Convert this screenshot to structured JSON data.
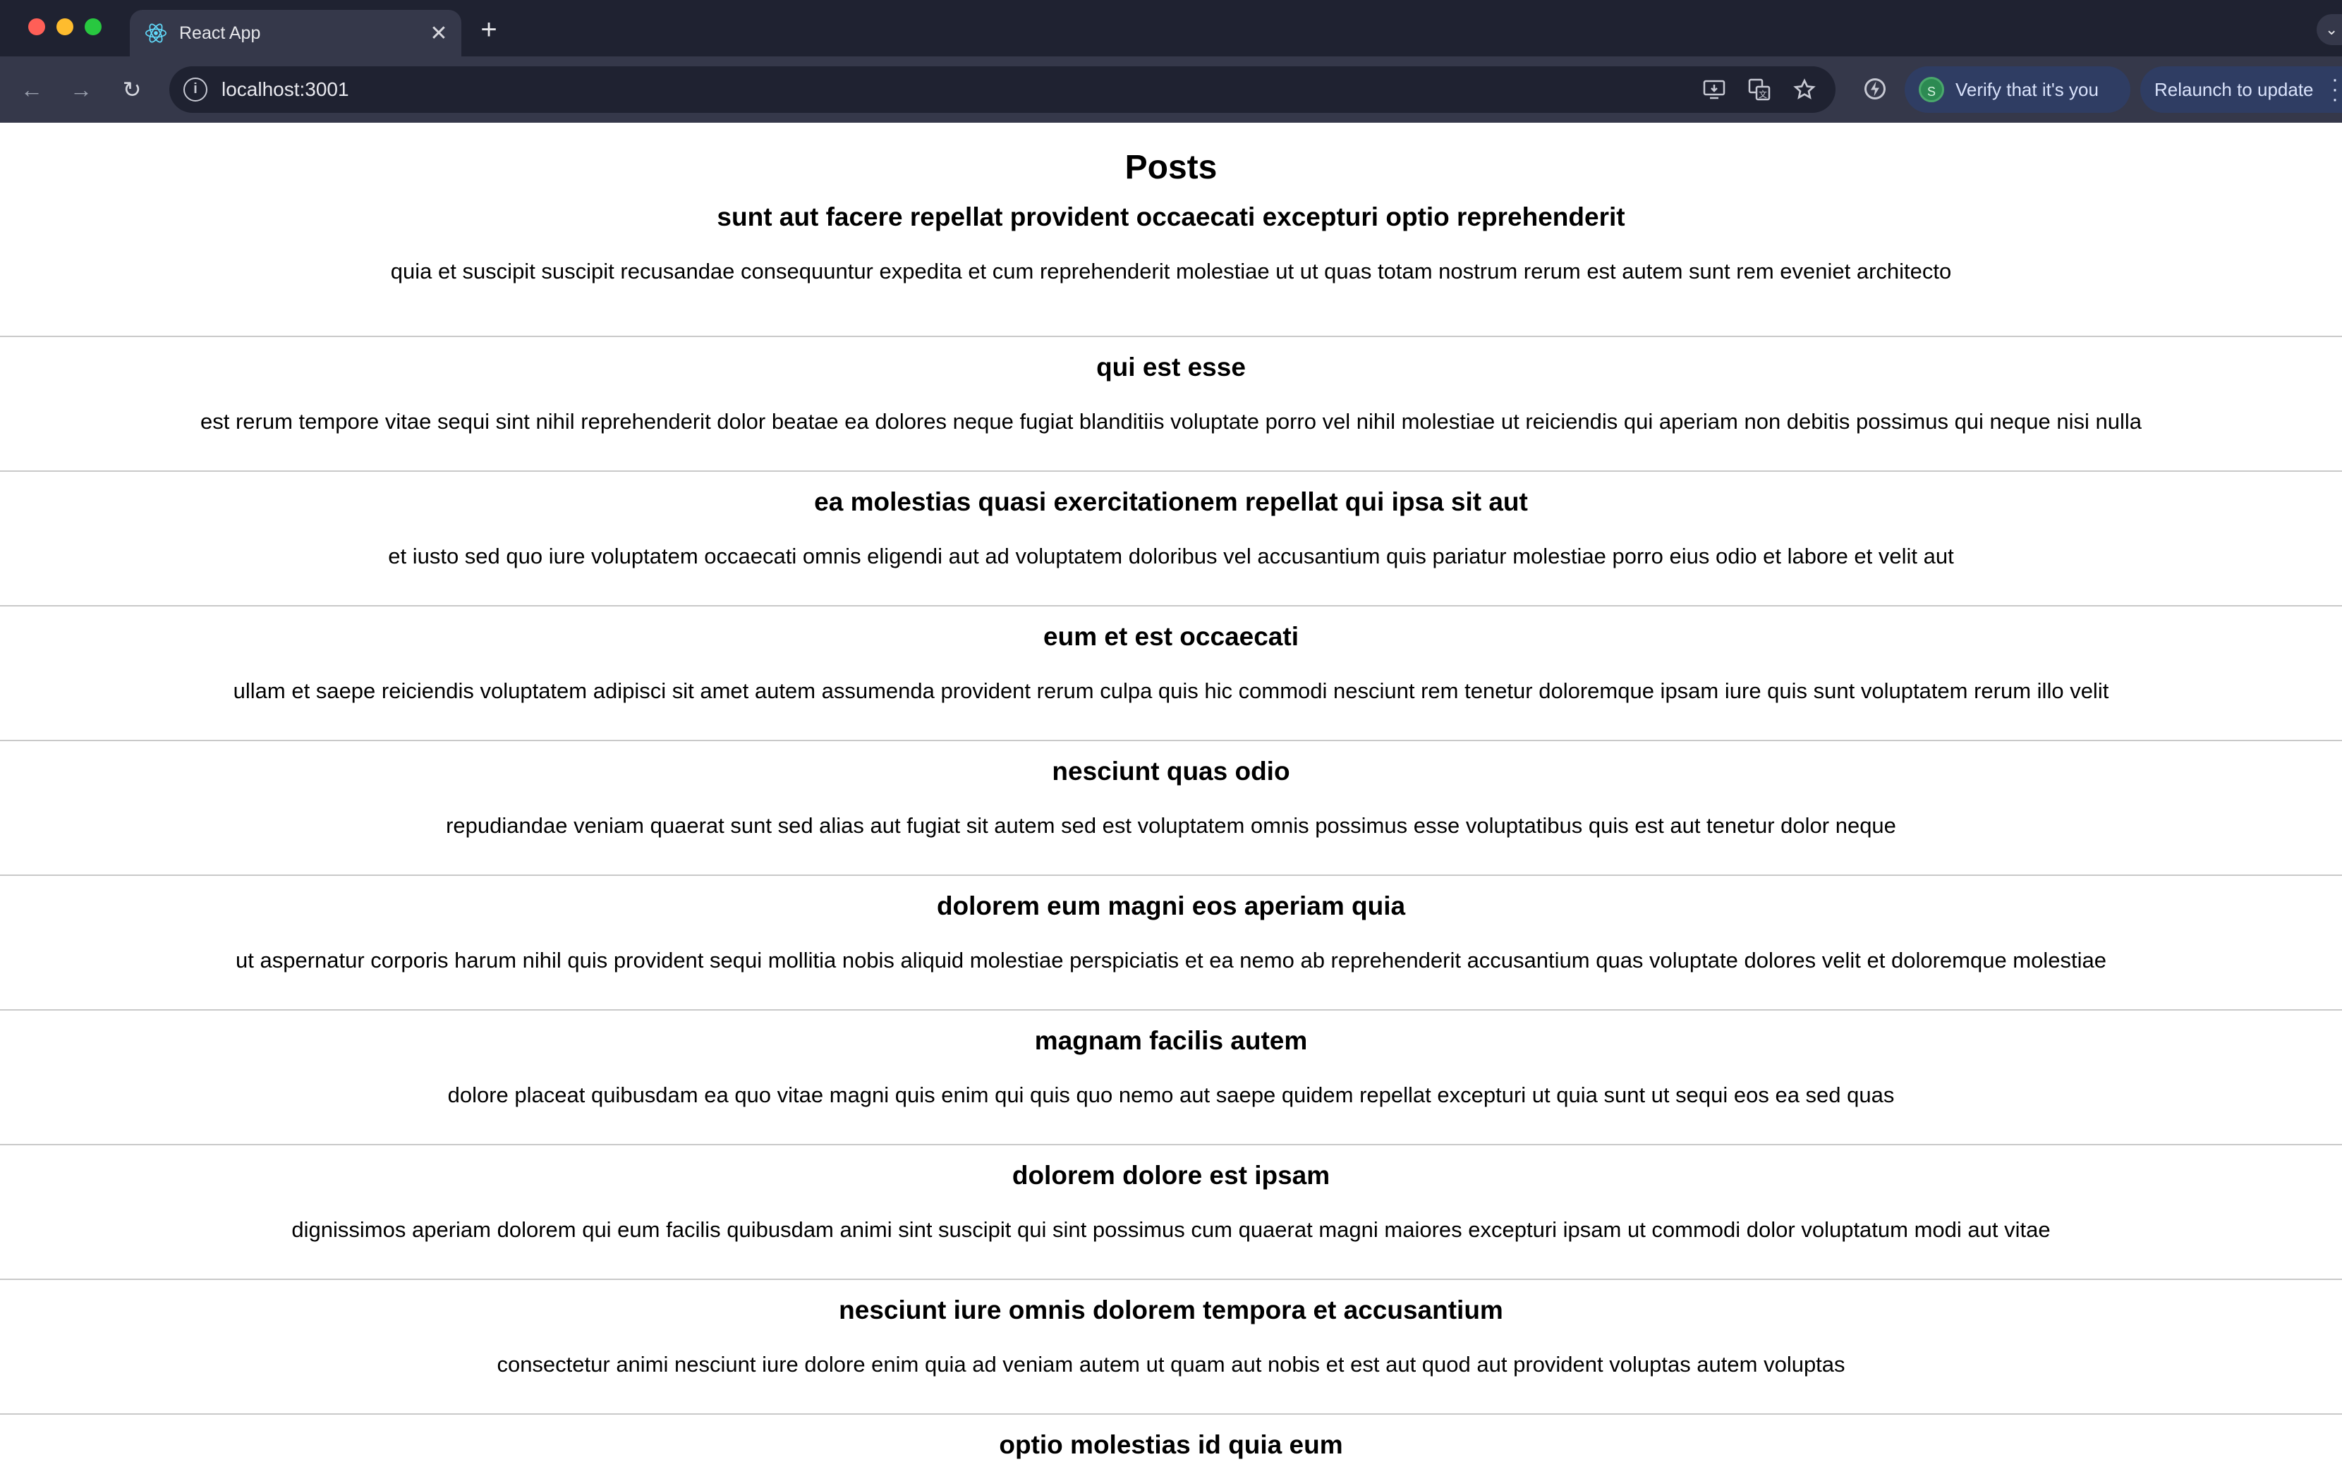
{
  "browser": {
    "tab": {
      "title": "React App",
      "favicon": "react-atom-icon"
    },
    "address": {
      "url": "localhost:3001"
    },
    "profile": {
      "avatar_letter": "S",
      "verify_label": "Verify that it's you"
    },
    "update": {
      "label": "Relaunch to update"
    }
  },
  "page": {
    "title": "Posts",
    "posts": [
      {
        "title": "sunt aut facere repellat provident occaecati excepturi optio reprehenderit",
        "body": "quia et suscipit suscipit recusandae consequuntur expedita et cum reprehenderit molestiae ut ut quas totam nostrum rerum est autem sunt rem eveniet architecto"
      },
      {
        "title": "qui est esse",
        "body": "est rerum tempore vitae sequi sint nihil reprehenderit dolor beatae ea dolores neque fugiat blanditiis voluptate porro vel nihil molestiae ut reiciendis qui aperiam non debitis possimus qui neque nisi nulla"
      },
      {
        "title": "ea molestias quasi exercitationem repellat qui ipsa sit aut",
        "body": "et iusto sed quo iure voluptatem occaecati omnis eligendi aut ad voluptatem doloribus vel accusantium quis pariatur molestiae porro eius odio et labore et velit aut"
      },
      {
        "title": "eum et est occaecati",
        "body": "ullam et saepe reiciendis voluptatem adipisci sit amet autem assumenda provident rerum culpa quis hic commodi nesciunt rem tenetur doloremque ipsam iure quis sunt voluptatem rerum illo velit"
      },
      {
        "title": "nesciunt quas odio",
        "body": "repudiandae veniam quaerat sunt sed alias aut fugiat sit autem sed est voluptatem omnis possimus esse voluptatibus quis est aut tenetur dolor neque"
      },
      {
        "title": "dolorem eum magni eos aperiam quia",
        "body": "ut aspernatur corporis harum nihil quis provident sequi mollitia nobis aliquid molestiae perspiciatis et ea nemo ab reprehenderit accusantium quas voluptate dolores velit et doloremque molestiae"
      },
      {
        "title": "magnam facilis autem",
        "body": "dolore placeat quibusdam ea quo vitae magni quis enim qui quis quo nemo aut saepe quidem repellat excepturi ut quia sunt ut sequi eos ea sed quas"
      },
      {
        "title": "dolorem dolore est ipsam",
        "body": "dignissimos aperiam dolorem qui eum facilis quibusdam animi sint suscipit qui sint possimus cum quaerat magni maiores excepturi ipsam ut commodi dolor voluptatum modi aut vitae"
      },
      {
        "title": "nesciunt iure omnis dolorem tempora et accusantium",
        "body": "consectetur animi nesciunt iure dolore enim quia ad veniam autem ut quam aut nobis et est aut quod aut provident voluptas autem voluptas"
      },
      {
        "title": "optio molestias id quia eum",
        "body": ""
      }
    ]
  }
}
